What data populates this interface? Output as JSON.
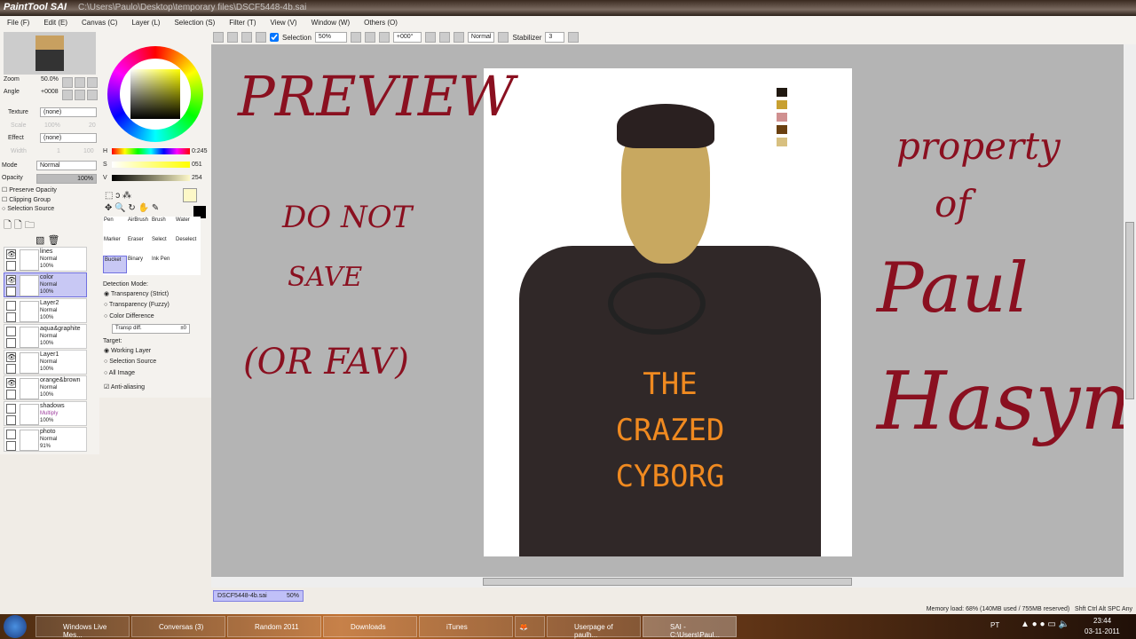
{
  "window": {
    "app": "PaintTool SAI",
    "path": "C:\\Users\\Paulo\\Desktop\\temporary files\\DSCF5448-4b.sai"
  },
  "menu": [
    "File (F)",
    "Edit (E)",
    "Canvas (C)",
    "Layer (L)",
    "Selection (S)",
    "Filter (T)",
    "View (V)",
    "Window (W)",
    "Others (O)"
  ],
  "toolbar": {
    "selection_label": "Selection",
    "zoom": "50%",
    "angle": "+000°",
    "mode": "Normal",
    "stabilizer_label": "Stabilizer",
    "stabilizer": "3"
  },
  "navigator": {
    "zoom_label": "Zoom",
    "zoom": "50.0%",
    "angle_label": "Angle",
    "angle": "+0008"
  },
  "brush": {
    "texture_label": "Texture",
    "texture": "(none)",
    "scale_label": "Scale",
    "scale": "100%",
    "scale2": "20",
    "effect_label": "Effect",
    "effect": "(none)",
    "width_label": "Width",
    "width": "1",
    "width2": "100",
    "mode_label": "Mode",
    "mode": "Normal",
    "opacity_label": "Opacity",
    "opacity": "100%",
    "preserve": "Preserve Opacity",
    "clipping": "Clipping Group",
    "selsource": "Selection Source"
  },
  "color": {
    "h_label": "H",
    "h": "0:245",
    "s_label": "S",
    "s": "051",
    "v_label": "V",
    "v": "254",
    "fg": "#fdf8c8",
    "bg": "#000000"
  },
  "layers": [
    {
      "name": "lines",
      "mode": "Normal",
      "opacity": "100%",
      "visible": true
    },
    {
      "name": "color",
      "mode": "Normal",
      "opacity": "100%",
      "visible": true,
      "selected": true
    },
    {
      "name": "Layer2",
      "mode": "Normal",
      "opacity": "100%",
      "visible": false
    },
    {
      "name": "aqua&graphite",
      "mode": "Normal",
      "opacity": "100%",
      "visible": false
    },
    {
      "name": "Layer1",
      "mode": "Normal",
      "opacity": "100%",
      "visible": true
    },
    {
      "name": "orange&brown",
      "mode": "Normal",
      "opacity": "100%",
      "visible": true
    },
    {
      "name": "shadows",
      "mode": "Multiply",
      "opacity": "100%",
      "visible": false
    },
    {
      "name": "photo",
      "mode": "Normal",
      "opacity": "91%",
      "visible": false
    }
  ],
  "tools": [
    "Pen",
    "AirBrush",
    "Brush",
    "Water",
    "Marker",
    "Eraser",
    "Select",
    "Deselect",
    "Bucket",
    "Binary",
    "Ink Pen"
  ],
  "bucket": {
    "detection_label": "Detection Mode:",
    "detection": [
      "Transparency (Strict)",
      "Transparency (Fuzzy)",
      "Color Difference"
    ],
    "transp_label": "Transp diff.",
    "transp": "±0",
    "target_label": "Target:",
    "targets": [
      "Working Layer",
      "Selection Source",
      "All Image"
    ],
    "antialias": "Anti-aliasing"
  },
  "canvas": {
    "notes": [
      "PREVIEW",
      "DO NOT",
      "SAVE",
      "(OR FAV)",
      "property",
      "of",
      "Paul",
      "Hasyn"
    ],
    "shirt_text": [
      "THE",
      "CRAZED",
      "CYBORG"
    ]
  },
  "doc_tab": {
    "name": "DSCF5448-4b.sai",
    "zoom": "50%"
  },
  "status": {
    "memory": "Memory load: 68% (140MB used / 755MB reserved)",
    "keys": "Shft Ctrl Alt SPC Any"
  },
  "taskbar": {
    "items": [
      "Windows Live Mes...",
      "Conversas (3)",
      "Random 2011",
      "Downloads",
      "iTunes",
      "",
      "Userpage of paulh...",
      "SAI - C:\\Users\\Paul..."
    ],
    "lang": "PT",
    "time": "23:44",
    "date": "03-11-2011"
  }
}
